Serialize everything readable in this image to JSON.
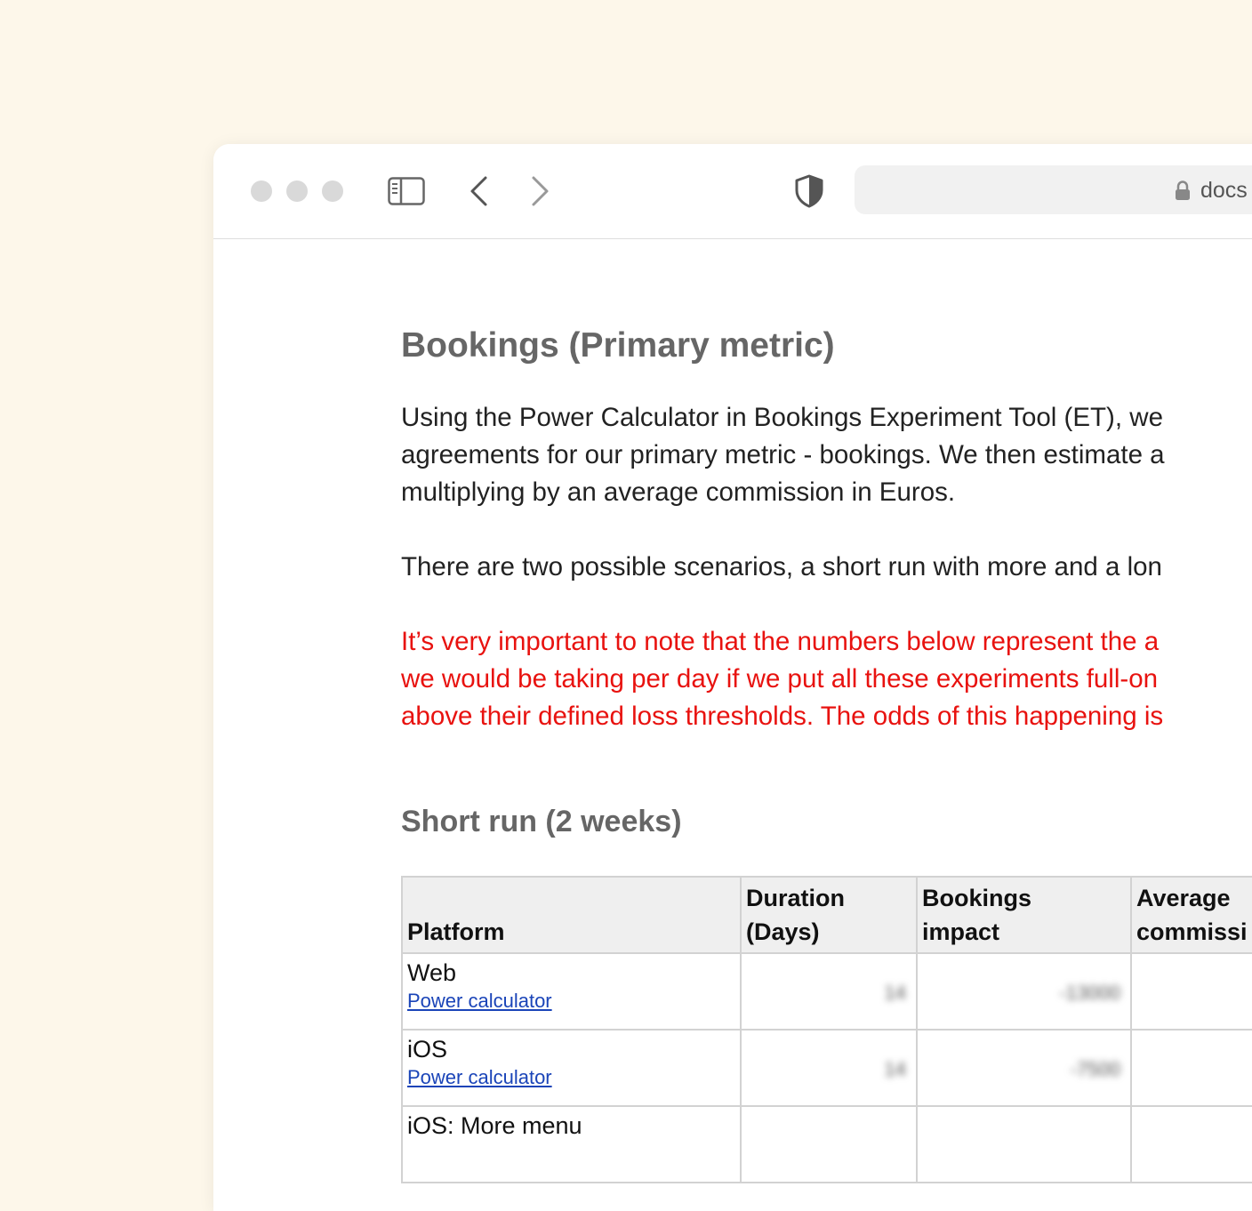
{
  "browser": {
    "url_text": "docs",
    "icons": [
      "sidebar-toggle-icon",
      "back-chevron-icon",
      "forward-chevron-icon",
      "privacy-shield-icon",
      "lock-icon"
    ]
  },
  "document": {
    "heading": "Bookings (Primary metric)",
    "paragraph1_lines": [
      "Using the Power Calculator in Bookings Experiment Tool (ET), we",
      "agreements for our primary metric - bookings. We then estimate a",
      "multiplying by an average commission in Euros."
    ],
    "paragraph2_lines": [
      "There are two possible scenarios, a short run with more and a lon"
    ],
    "warning_lines": [
      "It’s very important to note that the numbers below represent the a",
      "we would be taking per day if we put all these experiments full-on",
      "above their defined loss thresholds. The odds of this happening is"
    ],
    "warning_color": "#e8120f",
    "subheading": "Short run (2 weeks)",
    "table": {
      "headers": {
        "platform": "Platform",
        "duration_line1": "Duration",
        "duration_line2": "(Days)",
        "impact_line1": "Bookings",
        "impact_line2": "impact",
        "commission_line1": "Average",
        "commission_line2": "commissi"
      },
      "rows": [
        {
          "platform": "Web",
          "link": "Power calculator",
          "duration": "14",
          "impact": "-13000"
        },
        {
          "platform": "iOS",
          "link": "Power calculator",
          "duration": "14",
          "impact": "-7500"
        },
        {
          "platform": "iOS: More menu",
          "link": "",
          "duration": "",
          "impact": ""
        }
      ]
    }
  }
}
